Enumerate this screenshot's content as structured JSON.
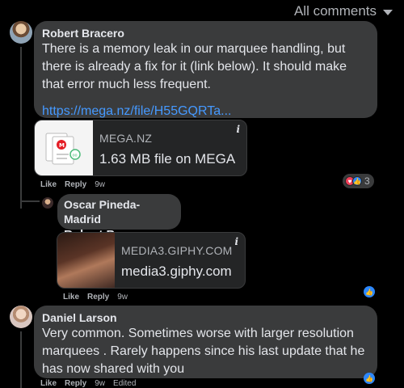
{
  "filter": {
    "label": "All comments"
  },
  "comments": [
    {
      "author": "Robert Bracero",
      "text": "There is a memory leak in our marquee handling, but there is already a fix for it (link below). It should make that error much less frequent.",
      "link": "https://mega.nz/file/H55GQRTa...",
      "preview": {
        "domain": "MEGA.NZ",
        "title": "1.63 MB file on MEGA",
        "info_icon": "i"
      },
      "actions": {
        "like": "Like",
        "reply": "Reply",
        "time": "9w"
      },
      "reactions": {
        "icons": [
          "love-icon",
          "like-icon"
        ],
        "count": "3"
      }
    },
    {
      "author": "Oscar Pineda-Madrid",
      "text": "Robert Bracero",
      "preview": {
        "domain": "MEDIA3.GIPHY.COM",
        "title": "media3.giphy.com",
        "info_icon": "i"
      },
      "actions": {
        "like": "Like",
        "reply": "Reply",
        "time": "9w"
      },
      "reactions": {
        "icons": [
          "like-icon"
        ]
      }
    },
    {
      "author": "Daniel Larson",
      "text": "Very common. Sometimes worse with larger resolution marquees  . Rarely happens since his last update that he has now shared with you",
      "actions": {
        "like": "Like",
        "reply": "Reply",
        "time": "9w",
        "edited": "Edited"
      },
      "reactions": {
        "icons": [
          "like-icon"
        ]
      }
    }
  ],
  "colors": {
    "background": "#000000",
    "bubble": "#3a3b3c",
    "link": "#4599ff",
    "like_blue": "#2d88ff",
    "love_red": "#f33e58"
  }
}
